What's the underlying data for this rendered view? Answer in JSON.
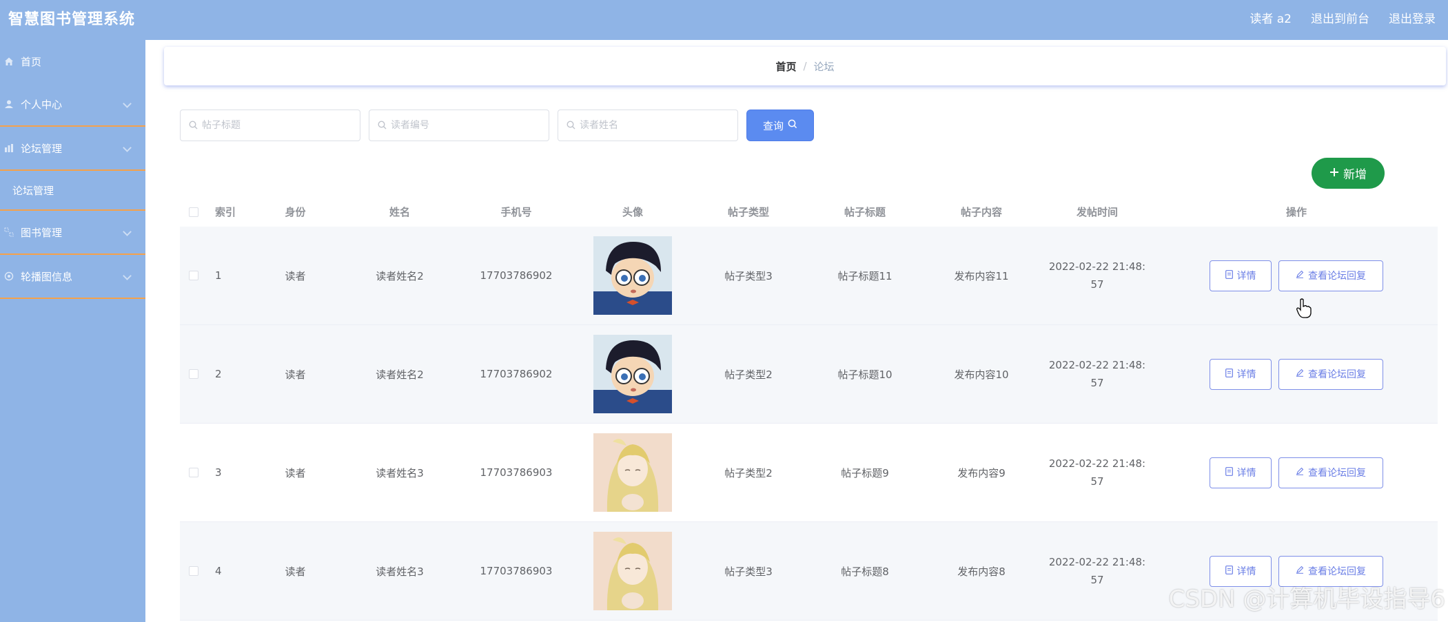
{
  "app": {
    "title": "智慧图书管理系统"
  },
  "header": {
    "user_label": "读者 a2",
    "back_to_front": "退出到前台",
    "logout": "退出登录"
  },
  "sidebar": {
    "items": [
      {
        "label": "首页",
        "icon": "home-icon"
      },
      {
        "label": "个人中心",
        "icon": "user-icon"
      },
      {
        "label": "论坛管理",
        "icon": "chart-icon"
      },
      {
        "label": "论坛管理",
        "icon": ""
      },
      {
        "label": "图书管理",
        "icon": "grid-icon"
      },
      {
        "label": "轮播图信息",
        "icon": "globe-icon"
      }
    ]
  },
  "breadcrumb": {
    "home": "首页",
    "separator": "/",
    "current": "论坛"
  },
  "search": {
    "title_placeholder": "帖子标题",
    "reader_no_placeholder": "读者编号",
    "reader_name_placeholder": "读者姓名",
    "query_label": "查询"
  },
  "actions": {
    "add_label": "新增"
  },
  "table": {
    "headers": [
      "索引",
      "身份",
      "姓名",
      "手机号",
      "头像",
      "帖子类型",
      "帖子标题",
      "帖子内容",
      "发帖时间",
      "操作"
    ],
    "rows": [
      {
        "index": "1",
        "role": "读者",
        "name": "读者姓名2",
        "phone": "17703786902",
        "type": "帖子类型3",
        "title": "帖子标题11",
        "content": "发布内容11",
        "time_line1": "2022-02-22 21:48:",
        "time_line2": "57",
        "avatar": "boy"
      },
      {
        "index": "2",
        "role": "读者",
        "name": "读者姓名2",
        "phone": "17703786902",
        "type": "帖子类型2",
        "title": "帖子标题10",
        "content": "发布内容10",
        "time_line1": "2022-02-22 21:48:",
        "time_line2": "57",
        "avatar": "boy"
      },
      {
        "index": "3",
        "role": "读者",
        "name": "读者姓名3",
        "phone": "17703786903",
        "type": "帖子类型2",
        "title": "帖子标题9",
        "content": "发布内容9",
        "time_line1": "2022-02-22 21:48:",
        "time_line2": "57",
        "avatar": "girl"
      },
      {
        "index": "4",
        "role": "读者",
        "name": "读者姓名3",
        "phone": "17703786903",
        "type": "帖子类型3",
        "title": "帖子标题8",
        "content": "发布内容8",
        "time_line1": "2022-02-22 21:48:",
        "time_line2": "57",
        "avatar": "girl"
      }
    ],
    "detail_label": "详情",
    "reply_label": "查看论坛回复"
  },
  "watermark": "CSDN @计算机毕设指导6",
  "colors": {
    "topbar": "#8fb4e6",
    "query_button": "#5b8bf0",
    "add_button": "#1f9a4a",
    "op_border": "#7d8ee8",
    "sidebar_divider": "#f5a14a"
  }
}
